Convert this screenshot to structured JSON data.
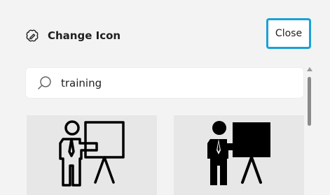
{
  "header": {
    "title": "Change Icon",
    "icon": "change-icon-icon"
  },
  "close_button": {
    "label": "Close"
  },
  "search": {
    "value": "training",
    "icon": "search-icon"
  },
  "results": [
    {
      "name": "presentation-outline-icon",
      "style": "outline"
    },
    {
      "name": "presentation-filled-icon",
      "style": "filled"
    }
  ],
  "colors": {
    "accent": "#19a1d6",
    "background": "#f3f3f3",
    "tile": "#e7e7e7"
  }
}
